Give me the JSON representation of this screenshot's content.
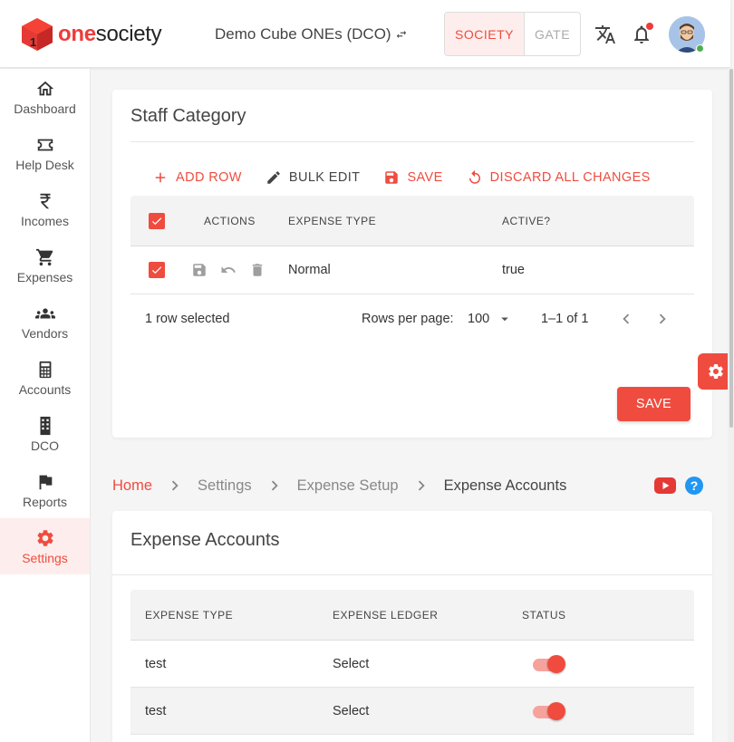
{
  "brand": {
    "one": "one",
    "society": "society"
  },
  "header": {
    "society_name": "Demo Cube ONEs (DCO)",
    "segments": [
      "SOCIETY",
      "GATE"
    ]
  },
  "sidebar": {
    "items": [
      {
        "label": "Dashboard",
        "icon": "home-icon"
      },
      {
        "label": "Help Desk",
        "icon": "ticket-icon"
      },
      {
        "label": "Incomes",
        "icon": "rupee-icon"
      },
      {
        "label": "Expenses",
        "icon": "cart-icon"
      },
      {
        "label": "Vendors",
        "icon": "people-icon"
      },
      {
        "label": "Accounts",
        "icon": "calculator-icon"
      },
      {
        "label": "DCO",
        "icon": "building-icon"
      },
      {
        "label": "Reports",
        "icon": "flag-icon"
      },
      {
        "label": "Settings",
        "icon": "gear-icon"
      }
    ],
    "active": "Settings"
  },
  "staff_category": {
    "title": "Staff Category",
    "toolbar": {
      "add_row": "ADD ROW",
      "bulk_edit": "BULK EDIT",
      "save": "SAVE",
      "discard": "DISCARD ALL CHANGES"
    },
    "columns": [
      "ACTIONS",
      "EXPENSE TYPE",
      "ACTIVE?"
    ],
    "rows": [
      {
        "expense_type": "Normal",
        "active": "true",
        "selected": true
      }
    ],
    "footer": {
      "selected_text": "1 row selected",
      "rows_per_page_label": "Rows per page:",
      "rows_per_page_value": "100",
      "range": "1–1 of 1"
    },
    "save_button": "SAVE"
  },
  "breadcrumb": {
    "items": [
      "Home",
      "Settings",
      "Expense Setup",
      "Expense Accounts"
    ]
  },
  "expense_accounts": {
    "title": "Expense Accounts",
    "columns": [
      "EXPENSE TYPE",
      "EXPENSE LEDGER",
      "STATUS"
    ],
    "rows": [
      {
        "expense_type": "test",
        "ledger": "Select",
        "status": true
      },
      {
        "expense_type": "test",
        "ledger": "Select",
        "status": true
      }
    ]
  },
  "colors": {
    "accent": "#ef4c3f",
    "accent_light": "#fdeeed",
    "help": "#2196f3",
    "online": "#4caf50"
  }
}
